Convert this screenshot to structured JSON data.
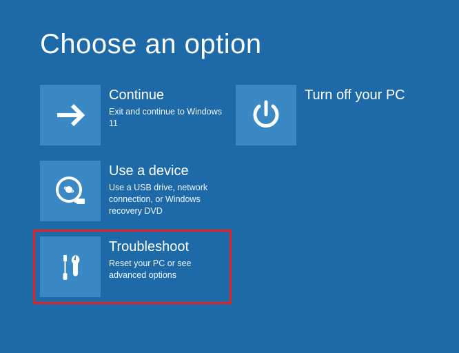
{
  "title": "Choose an option",
  "options": {
    "continue": {
      "label": "Continue",
      "desc": "Exit and continue to Windows 11"
    },
    "turnoff": {
      "label": "Turn off your PC",
      "desc": ""
    },
    "device": {
      "label": "Use a device",
      "desc": "Use a USB drive, network connection, or Windows recovery DVD"
    },
    "troubleshoot": {
      "label": "Troubleshoot",
      "desc": "Reset your PC or see advanced options"
    }
  },
  "colors": {
    "background": "#1e6aa8",
    "tile": "#3a88c4",
    "highlight": "#e62222"
  }
}
